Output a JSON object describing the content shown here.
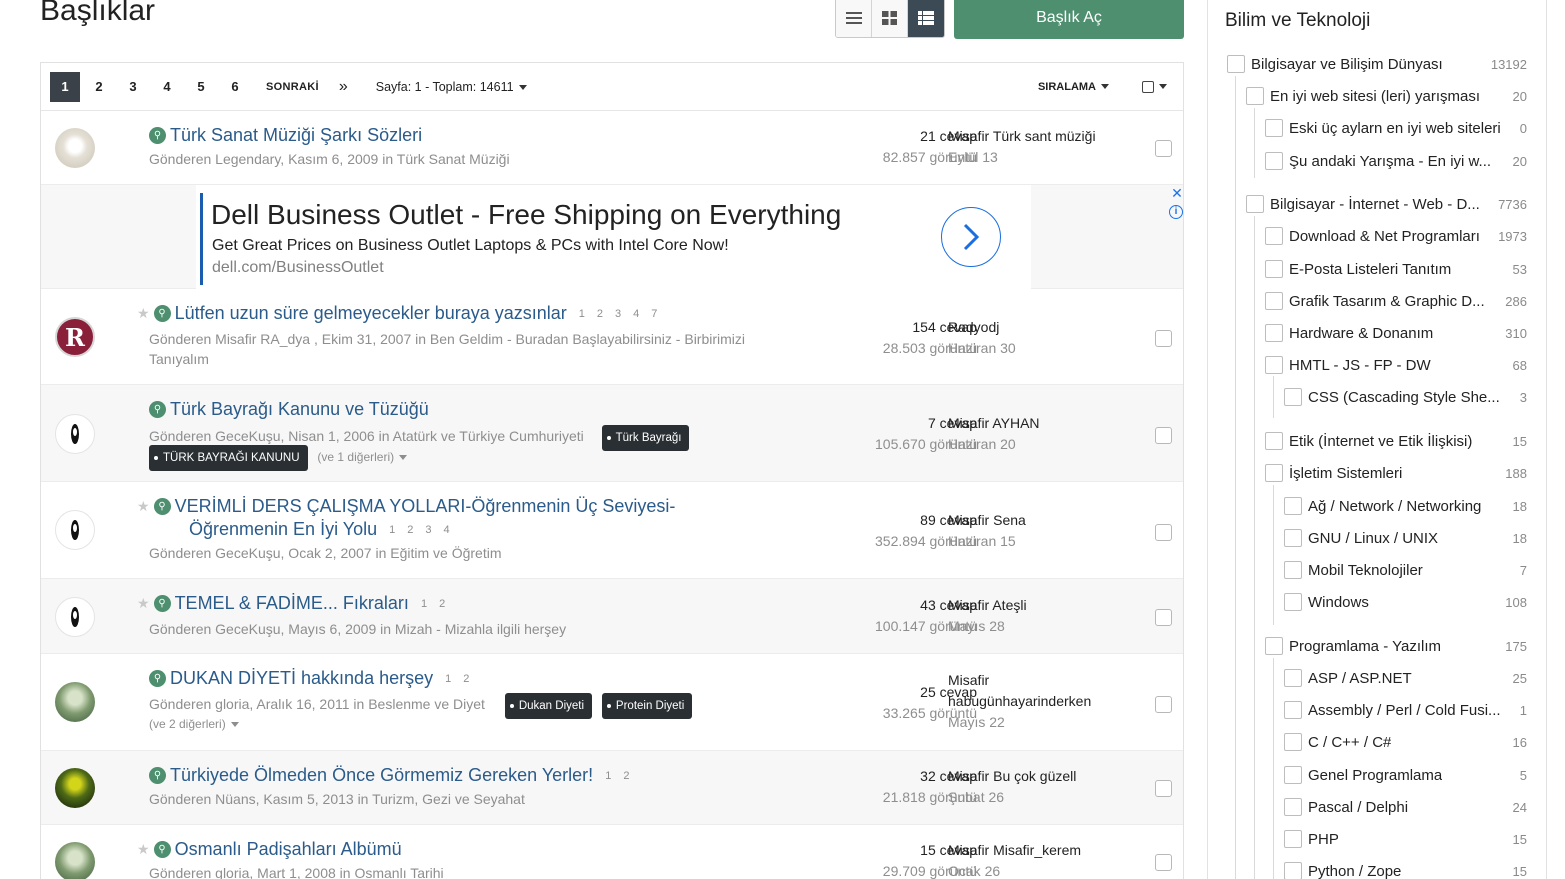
{
  "header": {
    "title": "Başlıklar",
    "new_topic_label": "Başlık Aç",
    "view_modes": [
      "list-view-icon",
      "grid-view-icon",
      "detailed-list-icon"
    ]
  },
  "pagination": {
    "pages": [
      "1",
      "2",
      "3",
      "4",
      "5",
      "6"
    ],
    "next_label": "SONRAKİ",
    "last_label": "»",
    "info": "Sayfa: 1 - Toplam: 14611",
    "sort_label": "SIRALAMA"
  },
  "topics": [
    {
      "title": "Türk Sanat Müziği Şarkı Sözleri",
      "meta": "Gönderen Legendary, Kasım 6, 2009 in Türk Sanat Müziği",
      "replies": "21 cevap",
      "views": "82.857 görüntü",
      "last_user": "Misafir Türk sant müziği",
      "last_date": "Eylül 13"
    },
    {
      "title": "Lütfen uzun süre gelmeyecekler buraya yazsınlar",
      "pages": [
        "1",
        "2",
        "3",
        "4",
        "7"
      ],
      "meta": "Gönderen Misafir RA_dya , Ekim 31, 2007 in Ben Geldim - Buradan Başlayabilirsiniz - Birbirimizi",
      "meta2": "Tanıyalım",
      "replies": "154 cevap",
      "views": "28.503 görüntü",
      "last_user": "Radyodj",
      "last_date": "Haziran 30"
    },
    {
      "title": "Türk Bayrağı Kanunu ve Tüzüğü",
      "meta": "Gönderen GeceKuşu, Nisan 1, 2006 in Atatürk ve Türkiye Cumhuriyeti",
      "tags": [
        "Türk Bayrağı",
        "TÜRK BAYRAĞI KANUNU"
      ],
      "more": "(ve 1 diğerleri)",
      "replies": "7 cevap",
      "views": "105.670 görüntü",
      "last_user": "Misafir AYHAN",
      "last_date": "Haziran 20"
    },
    {
      "title": "VERİMLİ DERS ÇALIŞMA YOLLARI-Öğrenmenin Üç Seviyesi-",
      "title2": "Öğrenmenin En İyi Yolu",
      "pages": [
        "1",
        "2",
        "3",
        "4"
      ],
      "meta": "Gönderen GeceKuşu, Ocak 2, 2007 in Eğitim ve Öğretim",
      "replies": "89 cevap",
      "views": "352.894 görüntü",
      "last_user": "Misafir Sena",
      "last_date": "Haziran 15"
    },
    {
      "title": "TEMEL & FADİME... Fıkraları",
      "pages": [
        "1",
        "2"
      ],
      "meta": "Gönderen GeceKuşu, Mayıs 6, 2009 in Mizah - Mizahla ilgili herşey",
      "replies": "43 cevap",
      "views": "100.147 görüntü",
      "last_user": "Misafir Ateşli",
      "last_date": "Mayıs 28"
    },
    {
      "title": "DUKAN DİYETİ hakkında herşey",
      "pages": [
        "1",
        "2"
      ],
      "meta": "Gönderen gloria, Aralık 16, 2011 in Beslenme ve Diyet",
      "tags": [
        "Dukan Diyeti",
        "Protein Diyeti"
      ],
      "more": "(ve 2 diğerleri)",
      "replies": "25 cevap",
      "views": "33.265 görüntü",
      "last_user": "Misafir",
      "last_user2": "habugünhayarinderken",
      "last_date": "Mayıs 22"
    },
    {
      "title": "Türkiyede Ölmeden Önce Görmemiz Gereken Yerler!",
      "pages": [
        "1",
        "2"
      ],
      "meta": "Gönderen Nüans, Kasım 5, 2013 in Turizm, Gezi ve Seyahat",
      "replies": "32 cevap",
      "views": "21.818 görüntü",
      "last_user": "Misafir Bu çok güzell",
      "last_date": "Şubat 26"
    },
    {
      "title": "Osmanlı Padişahları Albümü",
      "meta": "Gönderen gloria, Mart 1, 2008 in Osmanlı Tarihi",
      "replies": "15 cevap",
      "views": "29.709 görüntü",
      "last_user": "Misafir Misafir_kerem",
      "last_date": "Ocak 26"
    }
  ],
  "ad": {
    "title": "Dell Business Outlet - Free Shipping on Everything",
    "desc": "Get Great Prices on Business Outlet Laptops & PCs with Intel Core Now!",
    "url": "dell.com/BusinessOutlet",
    "close": "✕",
    "info": "i"
  },
  "sidebar": {
    "title": "Bilim ve Teknoloji",
    "categories": [
      {
        "label": "Bilgisayar ve Bilişim Dünyası",
        "count": "13192"
      },
      {
        "label": "En iyi web sitesi (leri) yarışması",
        "count": "20"
      },
      {
        "label": "Eski üç aylarn en iyi web siteleri",
        "count": "0"
      },
      {
        "label": "Şu andaki Yarışma - En iyi w...",
        "count": "20"
      },
      {
        "label": "Bilgisayar - İnternet - Web - D...",
        "count": "7736"
      },
      {
        "label": "Download & Net Programları",
        "count": "1973"
      },
      {
        "label": "E-Posta Listeleri Tanıtım",
        "count": "53"
      },
      {
        "label": "Grafik Tasarım & Graphic D...",
        "count": "286"
      },
      {
        "label": "Hardware & Donanım",
        "count": "310"
      },
      {
        "label": "HMTL - JS - FP - DW",
        "count": "68"
      },
      {
        "label": "CSS (Cascading Style She...",
        "count": "3"
      },
      {
        "label": "Etik (İnternet ve Etik İlişkisi)",
        "count": "15"
      },
      {
        "label": "İşletim Sistemleri",
        "count": "188"
      },
      {
        "label": "Ağ / Network / Networking",
        "count": "18"
      },
      {
        "label": "GNU / Linux / UNIX",
        "count": "18"
      },
      {
        "label": "Mobil Teknolojiler",
        "count": "7"
      },
      {
        "label": "Windows",
        "count": "108"
      },
      {
        "label": "Programlama - Yazılım",
        "count": "175"
      },
      {
        "label": "ASP / ASP.NET",
        "count": "25"
      },
      {
        "label": "Assembly / Perl / Cold Fusi...",
        "count": "1"
      },
      {
        "label": "C / C++ / C#",
        "count": "16"
      },
      {
        "label": "Genel Programlama",
        "count": "5"
      },
      {
        "label": "Pascal / Delphi",
        "count": "24"
      },
      {
        "label": "PHP",
        "count": "15"
      },
      {
        "label": "Python / Zope",
        "count": "15"
      }
    ]
  },
  "colors": {
    "accent_green": "#4d8f6f",
    "link_blue": "#2a5b8a",
    "dark": "#3b4148"
  }
}
